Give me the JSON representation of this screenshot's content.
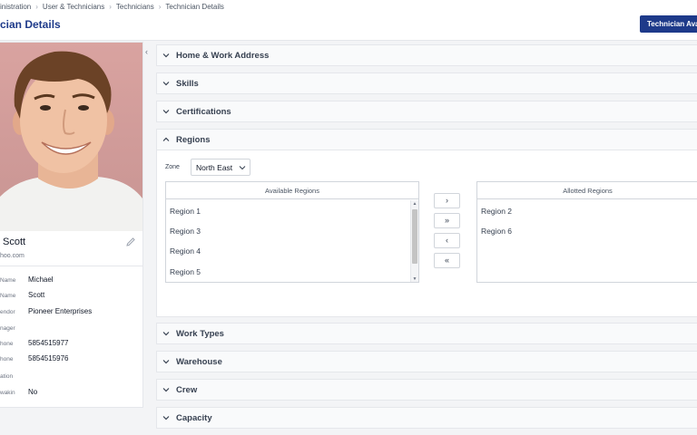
{
  "breadcrumb": [
    "inistration",
    "User & Technicians",
    "Technicians",
    "Technician Details"
  ],
  "page_title": "cian Details",
  "header_button": "Technician Ava",
  "profile": {
    "name": "Scott",
    "email": "hoo.com",
    "fields": [
      {
        "label": "Name",
        "value": "Michael"
      },
      {
        "label": "Name",
        "value": "Scott"
      },
      {
        "label": "endor",
        "value": "Pioneer Enterprises"
      },
      {
        "label": "nager",
        "value": ""
      },
      {
        "label": "hone",
        "value": "5854515977"
      },
      {
        "label": "hone",
        "value": "5854515976"
      },
      {
        "label": "ation",
        "value": ""
      },
      {
        "label": "wakin",
        "value": "No"
      }
    ]
  },
  "sections_top": [
    "Home & Work Address",
    "Skills",
    "Certifications",
    "Regions"
  ],
  "sections_bottom": [
    "Work Types",
    "Warehouse",
    "Crew",
    "Capacity"
  ],
  "regions": {
    "zone_label": "Zone",
    "zone_value": "North East",
    "available_header": "Available Regions",
    "allotted_header": "Allotted Regions",
    "available": [
      "Region 1",
      "Region 3",
      "Region 4",
      "Region 5"
    ],
    "allotted": [
      "Region 2",
      "Region 6"
    ],
    "buttons": [
      "›",
      "»",
      "‹",
      "«"
    ]
  }
}
